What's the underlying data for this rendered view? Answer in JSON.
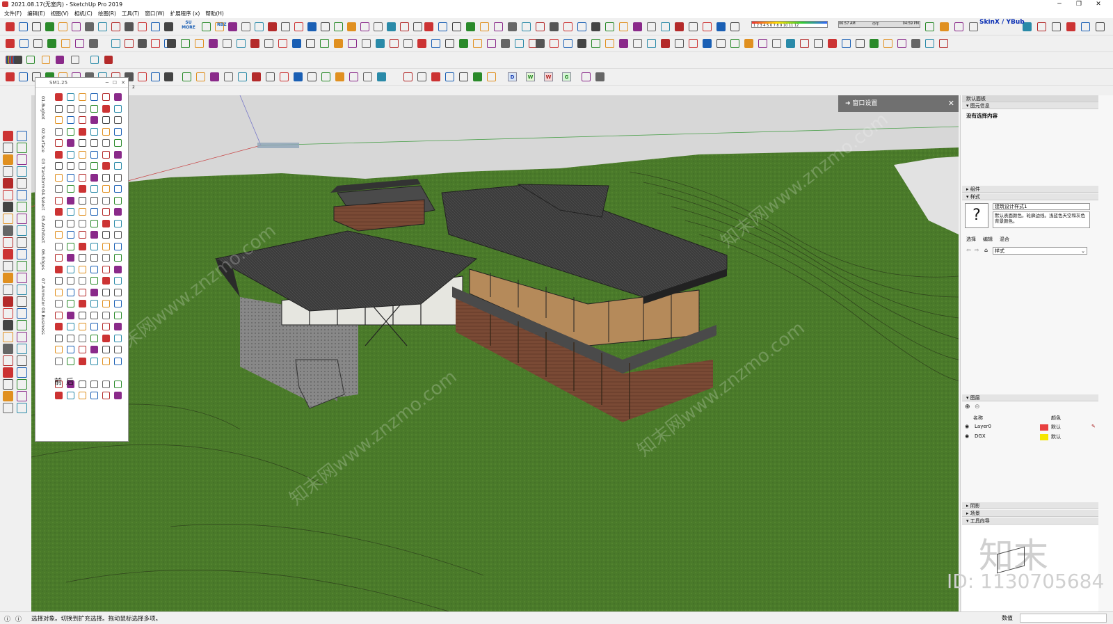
{
  "window": {
    "title": "2021.08.17(无室内) - SketchUp Pro 2019",
    "min": "─",
    "max": "❐",
    "close": "✕"
  },
  "menu": [
    "文件(F)",
    "编辑(E)",
    "视图(V)",
    "相机(C)",
    "绘图(R)",
    "工具(T)",
    "窗口(W)",
    "扩展程序 (x)",
    "帮助(H)"
  ],
  "toolbar": {
    "su_more": "SU MORE",
    "rbz": "RBZ",
    "time_left": "06:57 AM",
    "time_mid": "中午",
    "time_right": "04:59 PM",
    "months": "1 2 3 4 5 6 7 8 9 10 11 12",
    "skin_label": "SkinX / YBub",
    "tag_d": "D",
    "tag_w1": "W",
    "tag_w2": "W",
    "tag_g": "G",
    "tag_page": "2"
  },
  "float_window": {
    "title": "SM1.25",
    "tabs": [
      "01.Bugbot",
      "02.Surface",
      "03.Transform",
      "04.Select",
      "05.Architect",
      "06.Edges",
      "07.Animator",
      "08.Business"
    ],
    "nav_prev": "前",
    "nav_next": "后"
  },
  "viewport": {
    "banner": "窗口设置",
    "watermark": "知末网www.znzmo.com"
  },
  "right_panel": {
    "header": "默认面板",
    "entity_info": "图元信息",
    "no_selection": "没有选择内容",
    "components": "组件",
    "styles": "样式",
    "style_name": "建筑设计样式1",
    "style_desc": "默认表面颜色。轮廓边线。浅蓝色天空和灰色背景颜色。",
    "tabs": [
      "选择",
      "编辑",
      "混合"
    ],
    "style_dropdown": "样式",
    "layers": "图层",
    "layer_cols": [
      "名称",
      "颜色"
    ],
    "layer_rows": [
      {
        "name": "Layer0",
        "color_label": "默认",
        "color": "#e84040"
      },
      {
        "name": "DGX",
        "color_label": "默认",
        "color": "#f5e600"
      }
    ],
    "shadow": "阴影",
    "scenes": "场景",
    "instructor": "工具向导",
    "logo_text": "知末",
    "id_text": "ID: 1130705684"
  },
  "status": {
    "message": "选择对象。切换到扩充选择。拖动鼠标选择多项。",
    "measure_label": "数值"
  }
}
